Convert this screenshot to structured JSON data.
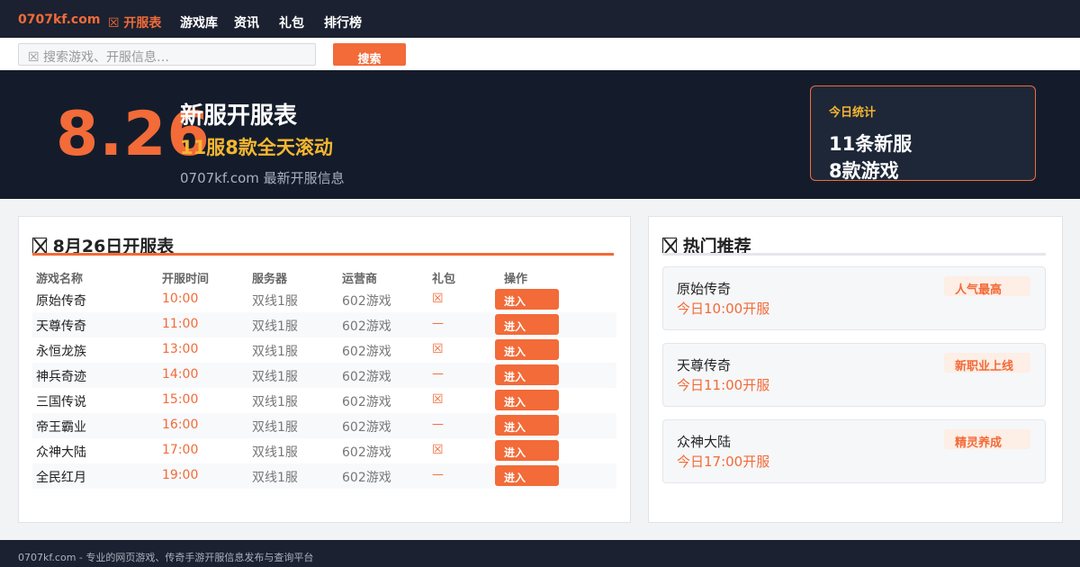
{
  "nav": {
    "logo": "0707kf.com",
    "items": [
      {
        "label": "☒ 开服表"
      },
      {
        "label": "游戏库"
      },
      {
        "label": "资讯"
      },
      {
        "label": "礼包"
      },
      {
        "label": "排行榜"
      }
    ],
    "accent_color": "#f26b38"
  },
  "search": {
    "placeholder": "☒ 搜索游戏、开服信息…",
    "button": "搜索"
  },
  "hero": {
    "date": "8.26",
    "title": "新服开服表",
    "subtitle": "11服8款全天滚动",
    "site_line": "0707kf.com 最新开服信息",
    "stats": {
      "label": "今日统计",
      "line1": "11条新服",
      "line2": "8款游戏"
    }
  },
  "schedule": {
    "title": "8月26日开服表",
    "headers": [
      "游戏名称",
      "开服时间",
      "服务器",
      "运营商",
      "礼包",
      "操作"
    ],
    "rows": [
      {
        "name": "原始传奇",
        "time": "10:00",
        "server": "双线1服",
        "operator": "602游戏",
        "gift": "☒",
        "action": "进入"
      },
      {
        "name": "天尊传奇",
        "time": "11:00",
        "server": "双线1服",
        "operator": "602游戏",
        "gift": "—",
        "action": "进入"
      },
      {
        "name": "永恒龙族",
        "time": "13:00",
        "server": "双线1服",
        "operator": "602游戏",
        "gift": "☒",
        "action": "进入"
      },
      {
        "name": "神兵奇迹",
        "time": "14:00",
        "server": "双线1服",
        "operator": "602游戏",
        "gift": "—",
        "action": "进入"
      },
      {
        "name": "三国传说",
        "time": "15:00",
        "server": "双线1服",
        "operator": "602游戏",
        "gift": "☒",
        "action": "进入"
      },
      {
        "name": "帝王霸业",
        "time": "16:00",
        "server": "双线1服",
        "operator": "602游戏",
        "gift": "—",
        "action": "进入"
      },
      {
        "name": "众神大陆",
        "time": "17:00",
        "server": "双线1服",
        "operator": "602游戏",
        "gift": "☒",
        "action": "进入"
      },
      {
        "name": "全民红月",
        "time": "19:00",
        "server": "双线1服",
        "operator": "602游戏",
        "gift": "—",
        "action": "进入"
      }
    ]
  },
  "hot": {
    "title": "热门推荐",
    "items": [
      {
        "name": "原始传奇",
        "time": "今日10:00开服",
        "tag": "人气最高"
      },
      {
        "name": "天尊传奇",
        "time": "今日11:00开服",
        "tag": "新职业上线"
      },
      {
        "name": "众神大陆",
        "time": "今日17:00开服",
        "tag": "精灵养成"
      }
    ]
  },
  "footer": {
    "text": "0707kf.com - 专业的网页游戏、传奇手游开服信息发布与查询平台"
  }
}
